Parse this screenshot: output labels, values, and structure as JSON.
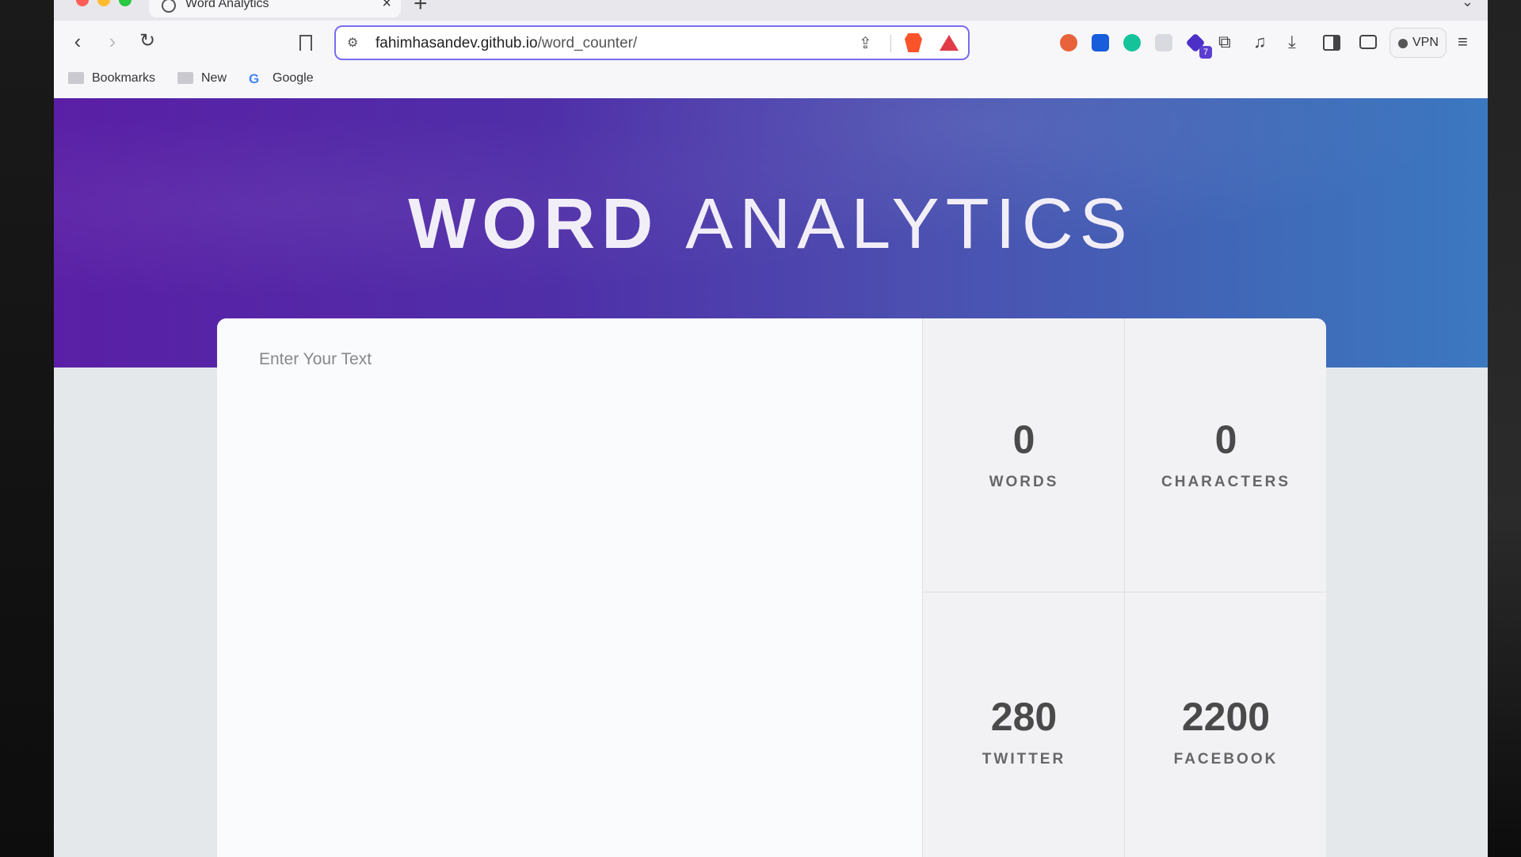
{
  "browser": {
    "tab_title": "Word Analytics",
    "url_host": "fahimhasandev.github.io",
    "url_path": "/word_counter/",
    "vpn_label": "VPN",
    "extension_badge": "7"
  },
  "bookmarks": [
    {
      "label": "Bookmarks",
      "icon": "folder-icon"
    },
    {
      "label": "New",
      "icon": "folder-icon"
    },
    {
      "label": "Google",
      "icon": "google-icon"
    }
  ],
  "hero": {
    "title_bold": "WORD",
    "title_light": "ANALYTICS"
  },
  "editor": {
    "placeholder": "Enter Your Text",
    "value": ""
  },
  "stats": [
    {
      "value": "0",
      "label": "WORDS"
    },
    {
      "value": "0",
      "label": "CHARACTERS"
    },
    {
      "value": "280",
      "label": "TWITTER"
    },
    {
      "value": "2200",
      "label": "FACEBOOK"
    }
  ]
}
